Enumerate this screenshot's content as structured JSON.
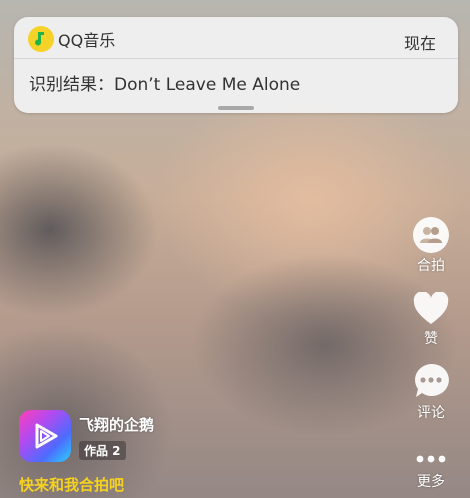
{
  "notification": {
    "app_name": "QQ音乐",
    "time": "现在",
    "body": "识别结果：Don’t Leave Me Alone"
  },
  "actions": {
    "duet": "合拍",
    "like": "赞",
    "comment": "评论",
    "more": "更多"
  },
  "author": {
    "name": "飞翔的企鹅",
    "works": "作品 2"
  },
  "cta": "快来和我合拍吧",
  "colors": {
    "cta_yellow": "#f6d21e",
    "qq_logo_yellow": "#f4d228",
    "qq_logo_green": "#1fb34a"
  },
  "icons": [
    "qq-music-logo-icon",
    "duet-icon",
    "heart-icon",
    "comment-icon",
    "more-dots-icon",
    "video-app-icon"
  ]
}
